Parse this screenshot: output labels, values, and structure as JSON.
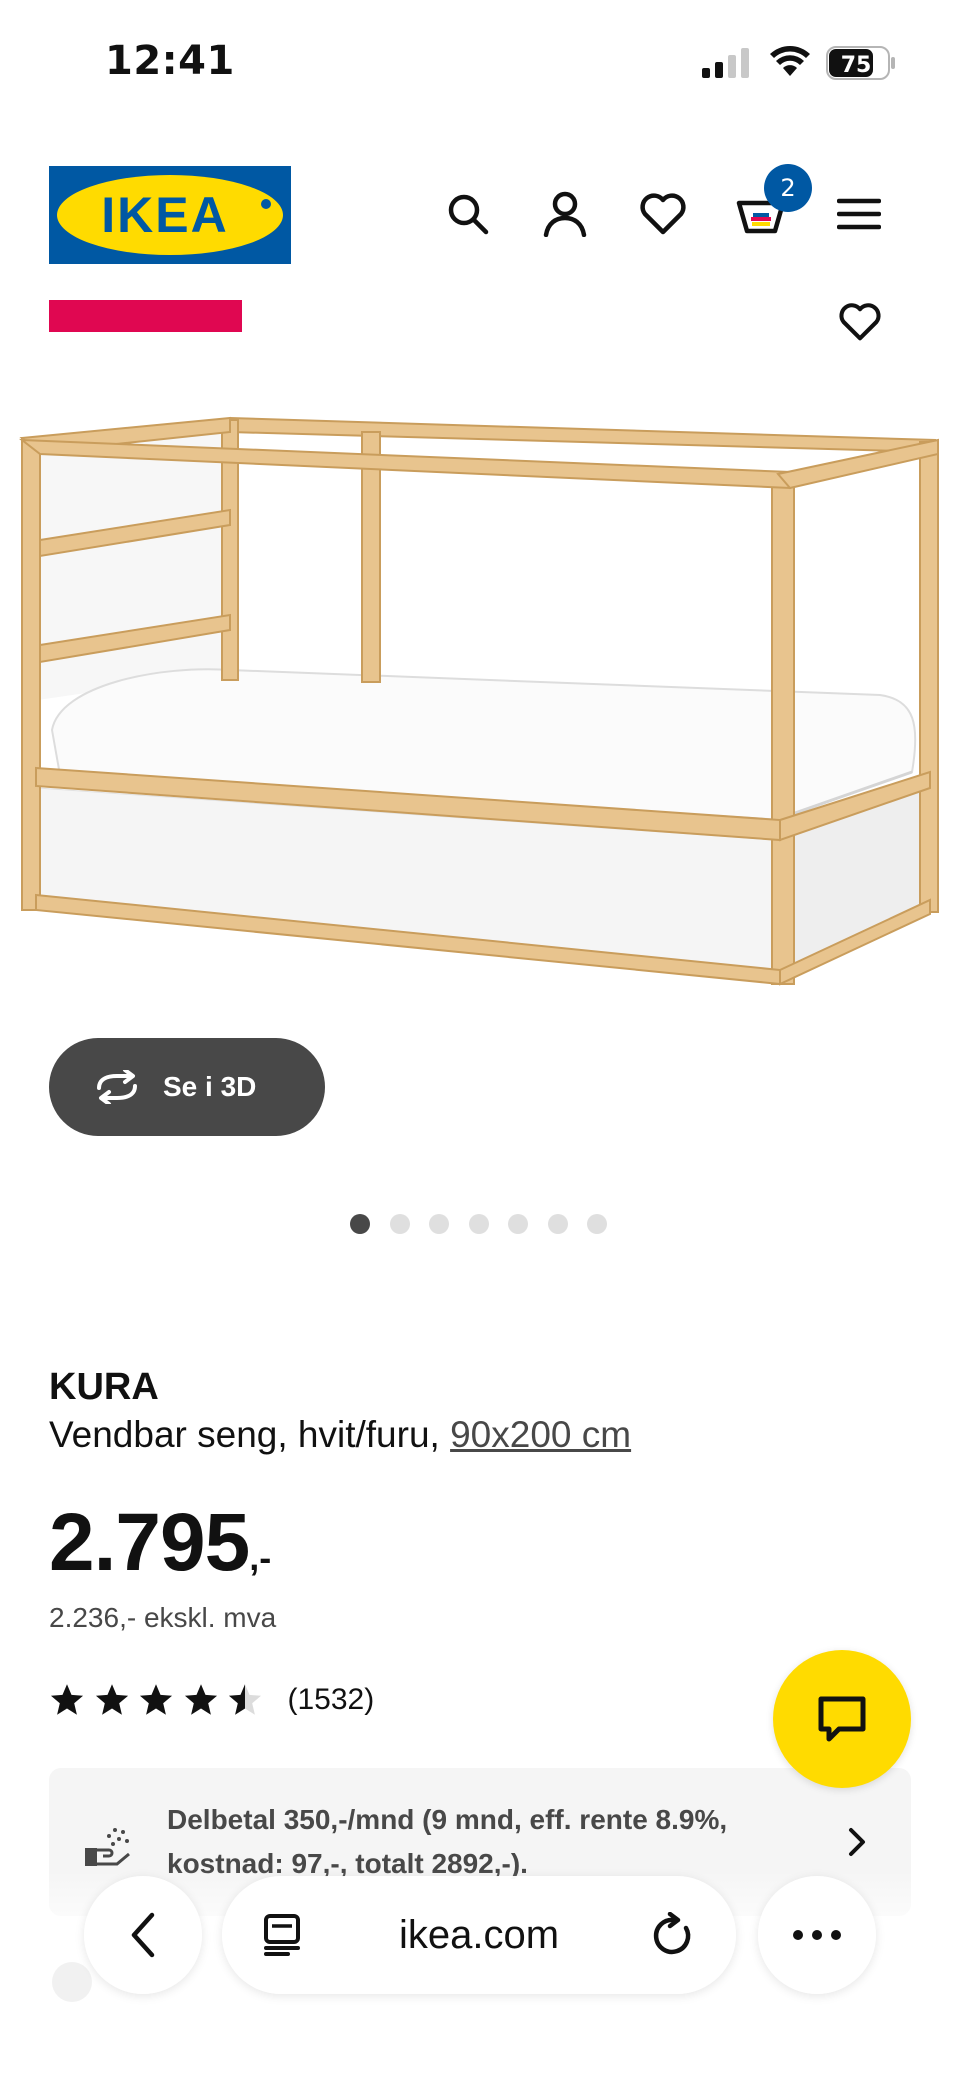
{
  "status_bar": {
    "time": "12:41",
    "battery": "75"
  },
  "header": {
    "logo_text": "IKEA",
    "cart_count": "2",
    "icons": [
      "search-icon",
      "profile-icon",
      "heart-icon",
      "cart-icon",
      "menu-icon"
    ]
  },
  "product": {
    "view_3d_label": "Se i 3D",
    "gallery_dots": 7,
    "gallery_active_index": 0,
    "name": "KURA",
    "description": "Vendbar seng, hvit/furu,",
    "size_link": "90x200 cm",
    "price_main": "2.795",
    "price_suffix": ",-",
    "price_ex_vat": "2.236,- ekskl. mva",
    "rating_value": 4.5,
    "rating_count": "(1532)"
  },
  "financing": {
    "text": "Delbetal 350,-/mnd (9 mnd, eff. rente 8.9%, kostnad: 97,-, totalt 2892,-)."
  },
  "browser": {
    "url": "ikea.com"
  },
  "colors": {
    "ikea_blue": "#0058a3",
    "ikea_yellow": "#ffdb00",
    "tag_pink": "#e00751",
    "button_dark": "#484848"
  }
}
